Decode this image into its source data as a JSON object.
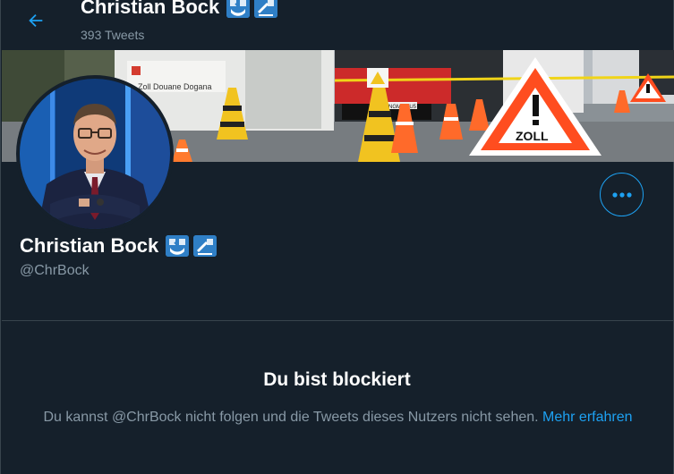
{
  "header": {
    "back_icon": "arrow-left-icon",
    "title": "Christian Bock",
    "tweet_count": "393 Tweets"
  },
  "profile": {
    "name": "Christian Bock",
    "handle": "@ChrBock",
    "badge_icons": [
      "customs-badge-icon",
      "customs-badge-icon"
    ],
    "more_icon": "more-options-icon"
  },
  "banner": {
    "sign_text": "Zoll Douane Dogana",
    "triangle_text": "ZOLL",
    "plate_text": "NGM-2VU5"
  },
  "blocked": {
    "title": "Du bist blockiert",
    "message": "Du kannst @ChrBock nicht folgen und die Tweets dieses Nutzers nicht sehen.",
    "link_label": "Mehr erfahren"
  },
  "colors": {
    "background": "#15202b",
    "accent": "#1da1f2",
    "secondary_text": "#8899a6",
    "border": "#38444d"
  }
}
